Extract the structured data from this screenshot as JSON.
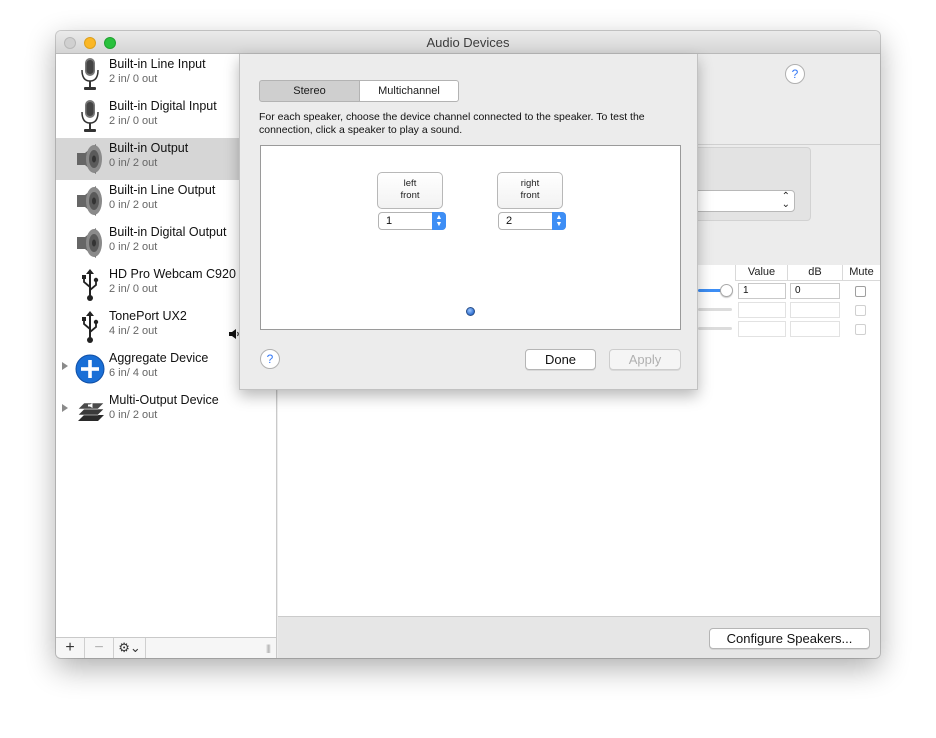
{
  "window": {
    "title": "Audio Devices"
  },
  "devices": [
    {
      "name": "Built-in Line Input",
      "io": "2 in/ 0 out",
      "icon": "microphone-icon",
      "selected": false
    },
    {
      "name": "Built-in Digital Input",
      "io": "2 in/ 0 out",
      "icon": "microphone-icon",
      "selected": false
    },
    {
      "name": "Built-in Output",
      "io": "0 in/ 2 out",
      "icon": "speaker-icon",
      "selected": true
    },
    {
      "name": "Built-in Line Output",
      "io": "0 in/ 2 out",
      "icon": "speaker-icon",
      "selected": false
    },
    {
      "name": "Built-in Digital Output",
      "io": "0 in/ 2 out",
      "icon": "speaker-icon",
      "selected": false
    },
    {
      "name": "HD Pro Webcam C920",
      "io": "2 in/ 0 out",
      "icon": "usb-icon",
      "selected": false
    },
    {
      "name": "TonePort UX2",
      "io": "4 in/ 2 out",
      "icon": "usb-icon",
      "selected": false
    },
    {
      "name": "Aggregate Device",
      "io": "6 in/ 4 out",
      "icon": "aggregate-plus-icon",
      "selected": false
    },
    {
      "name": "Multi-Output Device",
      "io": "0 in/ 2 out",
      "icon": "multi-output-icon",
      "selected": false
    }
  ],
  "sidebar_bottom": {
    "add": "+",
    "remove": "−",
    "gear": "⚙⌄",
    "grip": "|||"
  },
  "table": {
    "headers": {
      "value": "Value",
      "db": "dB",
      "mute": "Mute"
    },
    "row1": {
      "value": "1",
      "db": "0"
    }
  },
  "footer": {
    "configure_speakers": "Configure Speakers..."
  },
  "sheet": {
    "tabs": {
      "stereo": "Stereo",
      "multichannel": "Multichannel"
    },
    "instructions": "For each speaker, choose the device channel connected to the speaker. To test the connection, click a speaker to play a sound.",
    "left_speaker": {
      "line1": "left",
      "line2": "front",
      "channel": "1"
    },
    "right_speaker": {
      "line1": "right",
      "line2": "front",
      "channel": "2"
    },
    "done": "Done",
    "apply": "Apply"
  },
  "help": "?",
  "colors": {
    "accent": "#3d8ef5",
    "selection": "#d6d6d6"
  }
}
